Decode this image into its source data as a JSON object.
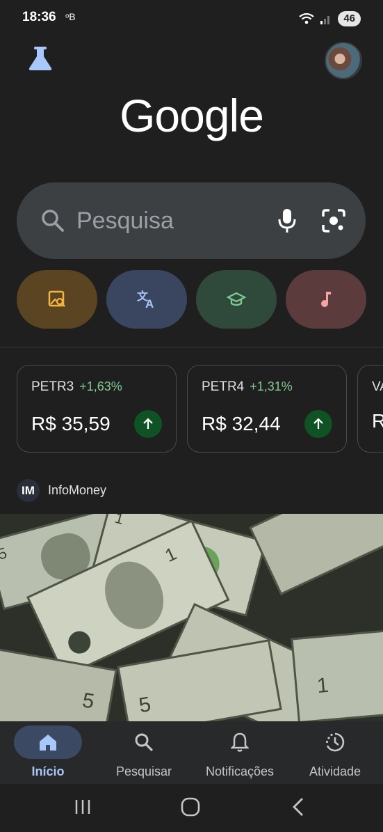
{
  "status_bar": {
    "time": "18:36",
    "extra": "ᵒB",
    "battery": "46"
  },
  "header": {
    "logo": "Google",
    "labs_icon": "flask-icon",
    "avatar": "profile-avatar"
  },
  "search": {
    "placeholder": "Pesquisa",
    "icons": [
      "search-icon",
      "microphone-icon",
      "lens-camera-icon"
    ]
  },
  "shortcuts": [
    {
      "name": "image-search",
      "icon": "image-search-icon",
      "color": "#5a4422",
      "icon_color": "#f6b53d"
    },
    {
      "name": "translate",
      "icon": "translate-icon",
      "color": "#3a4660",
      "icon_color": "#a8c7fa"
    },
    {
      "name": "homework",
      "icon": "graduation-cap-icon",
      "color": "#2f4a3a",
      "icon_color": "#81c995"
    },
    {
      "name": "music",
      "icon": "music-note-icon",
      "color": "#5b3b3b",
      "icon_color": "#f5a3a3"
    }
  ],
  "stocks": [
    {
      "ticker": "PETR3",
      "change": "+1,63%",
      "price": "R$ 35,59"
    },
    {
      "ticker": "PETR4",
      "change": "+1,31%",
      "price": "R$ 32,44"
    },
    {
      "ticker": "VA",
      "change": "",
      "price": "R"
    }
  ],
  "news": {
    "source_logo": "IM",
    "source_name": "InfoMoney",
    "image": "dollar-bills"
  },
  "bottom_nav": [
    {
      "label": "Início",
      "icon": "home-icon",
      "active": true
    },
    {
      "label": "Pesquisar",
      "icon": "search-icon",
      "active": false
    },
    {
      "label": "Notificações",
      "icon": "bell-icon",
      "active": false
    },
    {
      "label": "Atividade",
      "icon": "activity-icon",
      "active": false
    }
  ]
}
